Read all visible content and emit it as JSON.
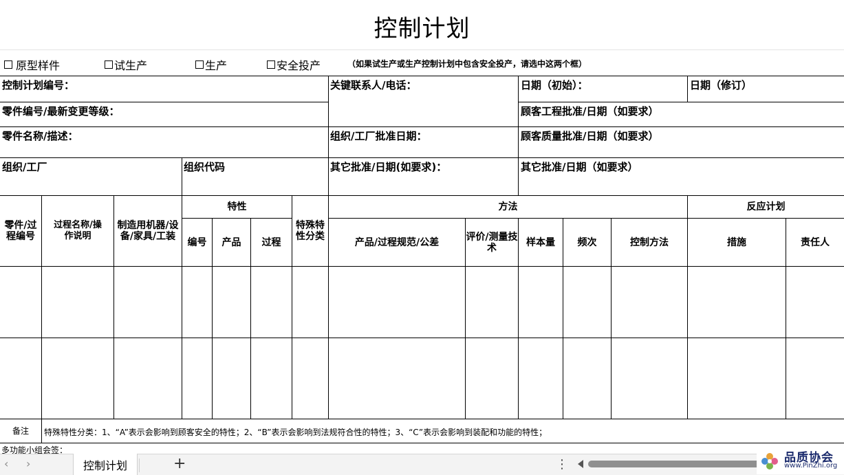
{
  "title": "控制计划",
  "options": {
    "prototype": "原型样件",
    "pre_launch": "试生产",
    "production": "生产",
    "safe_launch": "安全投产",
    "note": "（如果试生产或生产控制计划中包含安全投产，请选中这两个框）"
  },
  "header": {
    "plan_no": "控制计划编号：",
    "key_contact": "关键联系人/电话：",
    "date_orig": "日期（初始）：",
    "date_rev": "日期（修订）",
    "part_no": "零件编号/最新变更等级：",
    "cust_eng": "顾客工程批准/日期（如要求）",
    "part_name": "零件名称/描述：",
    "org_date": "组织/工厂批准日期：",
    "cust_qual": "顾客质量批准/日期（如要求）",
    "org": "组织/工厂",
    "org_code": "组织代码",
    "other1": "其它批准/日期(如要求)：",
    "other2": "其它批准/日期（如要求）"
  },
  "columns": {
    "part_proc_no": "零件/过程编号",
    "proc_name": "过程名称/操作说明",
    "machine": "制造用机器/设备/家具/工装",
    "characteristics": "特性",
    "char_no": "编号",
    "product": "产品",
    "process": "过程",
    "special": "特殊特性分类",
    "methods": "方法",
    "spec": "产品/过程规范/公差",
    "eval": "评价/测量技术",
    "sample": "样本量",
    "freq": "频次",
    "control": "控制方法",
    "reaction": "反应计划",
    "measure": "措施",
    "owner": "责任人"
  },
  "remarks": {
    "label": "备注",
    "text": "特殊特性分类：1、“A”表示会影响到顾客安全的特性；2、“B”表示会影响到法规符合性的特性；3、“C”表示会影响到装配和功能的特性；"
  },
  "team_sign": "多功能小组会签：",
  "sheet_tab": "控制计划",
  "nav": {
    "prev": "‹",
    "next": "›",
    "add": "+",
    "more": "⋮"
  },
  "brand": {
    "name": "品质协会",
    "url": "www.PinZhi.org"
  }
}
